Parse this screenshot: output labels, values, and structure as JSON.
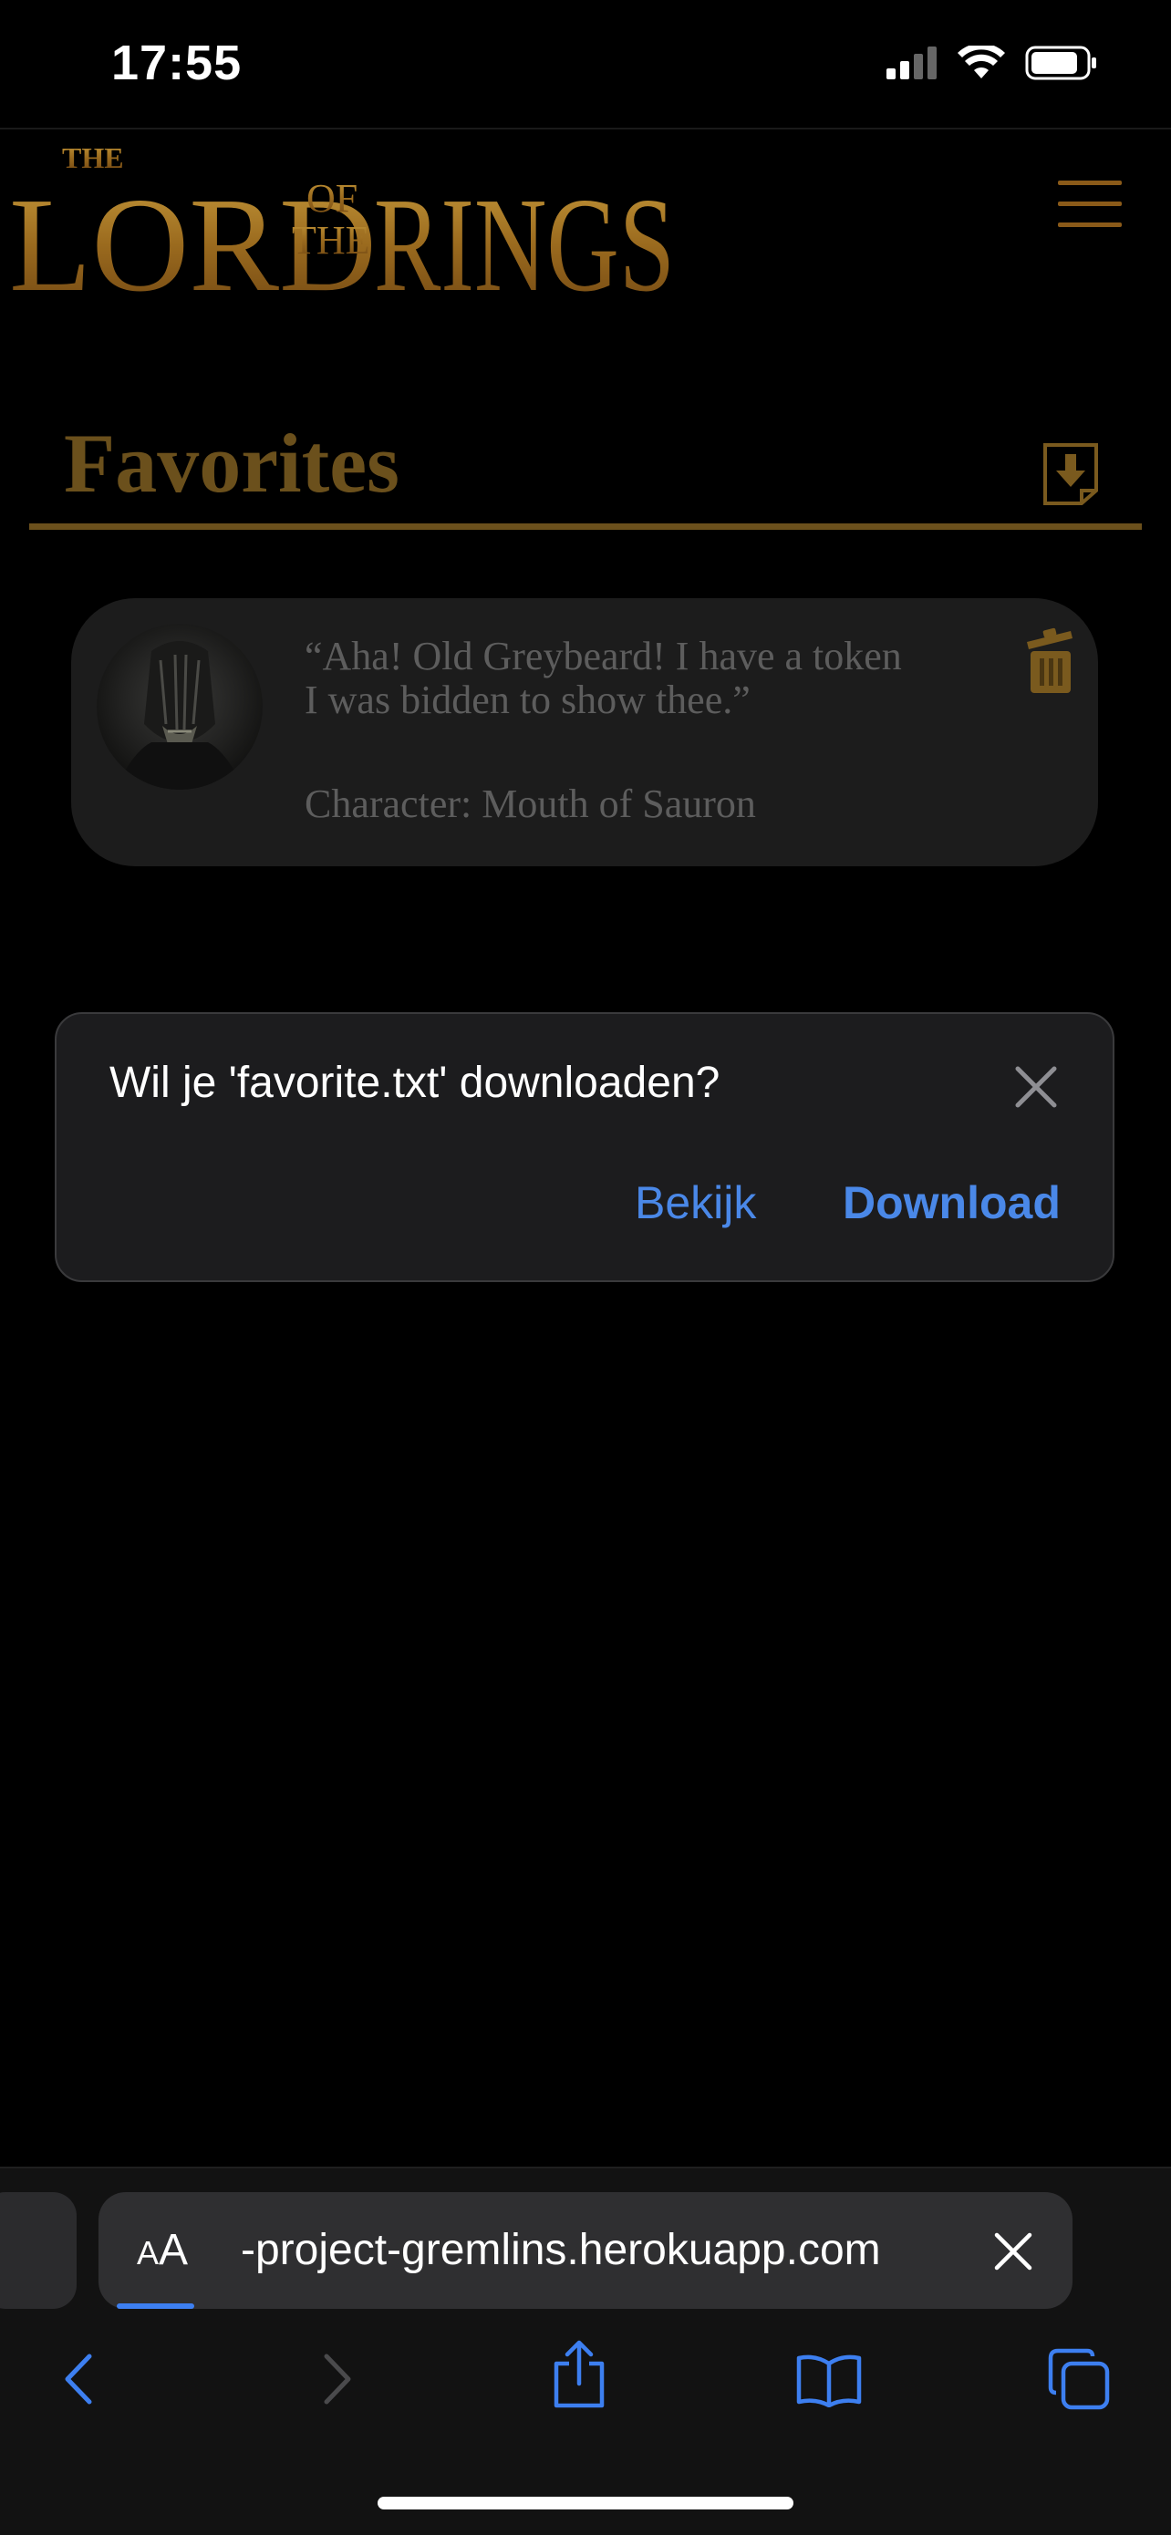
{
  "status_bar": {
    "time": "17:55"
  },
  "header": {
    "logo": {
      "the": "THE",
      "lord": "LORD",
      "of": "OF",
      "the2": "THE",
      "rings": "RINGS"
    }
  },
  "favorites": {
    "title": "Favorites",
    "items": [
      {
        "quote": "“Aha! Old Greybeard! I have a token I was bidden to show thee.”",
        "character_label": "Character:",
        "character_name": "Mouth of Sauron"
      }
    ]
  },
  "download_dialog": {
    "message": "Wil je 'favorite.txt' downloaden?",
    "view_label": "Bekijk",
    "download_label": "Download"
  },
  "browser": {
    "aa_small": "A",
    "aa_large": "A",
    "url": "-project-gremlins.herokuapp.com",
    "load_progress": 0.08
  },
  "colors": {
    "accent_gold": "#6b501c",
    "link_blue": "#4a88e8"
  }
}
